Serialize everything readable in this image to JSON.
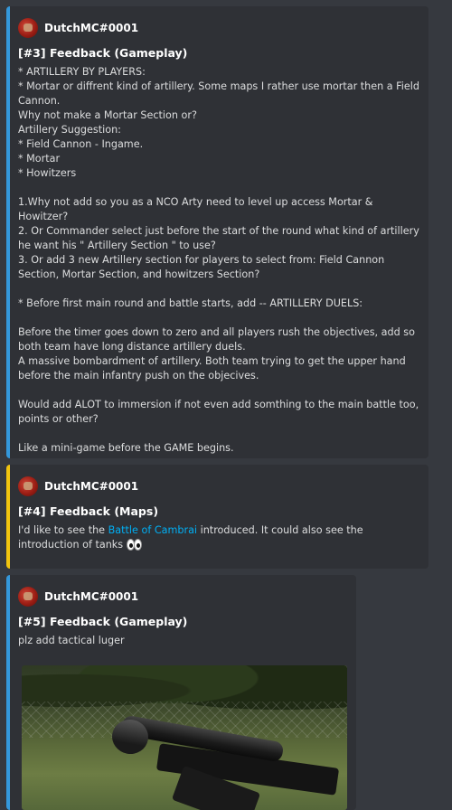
{
  "messages": [
    {
      "author": "DutchMC#0001",
      "title": "[#3] Feedback (Gameplay)",
      "description": "* ARTILLERY BY PLAYERS:\n* Mortar or diffrent kind of artillery. Some maps I rather use mortar then a Field Cannon.\nWhy not make a Mortar Section or?\nArtillery Suggestion:\n* Field Cannon - Ingame.\n* Mortar\n* Howitzers\n\n1.Why not add so you as a NCO Arty need to level up access Mortar & Howitzer?\n2. Or Commander select just before the start of the round what kind of artillery he want his \" Artillery Section \" to use?\n3. Or add 3 new Artillery section for players to select from: Field Cannon Section, Mortar Section, and howitzers Section?\n\n* Before first main round and battle starts, add -- ARTILLERY DUELS:\n\nBefore the timer goes down to zero and all players rush the objectives, add so both team have long distance artillery duels.\nA massive bombardment of artillery. Both team trying to get the upper hand before the main infantry push on the objecives.\n\nWould add ALOT to immersion if not even add somthing to the main battle too, points or other?\n\nLike a mini-game before the GAME begins.",
      "accent": "#3498db"
    },
    {
      "author": "DutchMC#0001",
      "title": "[#4] Feedback (Maps)",
      "desc_before": "I'd like to see the ",
      "desc_link": "Battle of Cambrai",
      "desc_after": " introduced. It could also see the introduction of tanks ",
      "emoji": "eyes-icon",
      "accent": "#f1c40f"
    },
    {
      "author": "DutchMC#0001",
      "title": "[#5] Feedback (Gameplay)",
      "description": "plz add tactical luger",
      "image": "rifle-with-scope-photo",
      "accent": "#3498db"
    }
  ]
}
